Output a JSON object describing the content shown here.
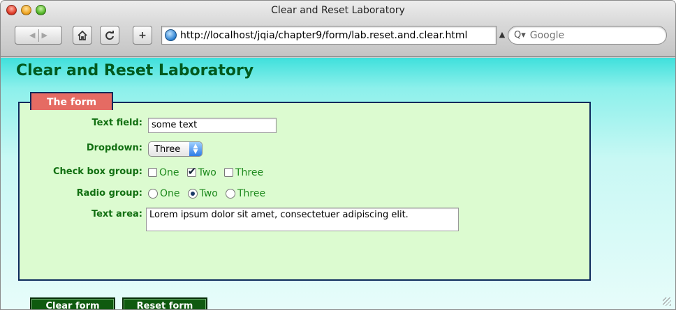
{
  "window": {
    "title": "Clear and Reset Laboratory"
  },
  "toolbar": {
    "back_icon": "back-arrow",
    "forward_icon": "forward-arrow",
    "home_icon": "home",
    "reload_icon": "reload",
    "add_icon": "plus",
    "url": "http://localhost/jqia/chapter9/form/lab.reset.and.clear.html",
    "search_placeholder": "Google"
  },
  "page": {
    "heading": "Clear and Reset Laboratory"
  },
  "form": {
    "legend": "The form",
    "text_field": {
      "label": "Text field:",
      "value": "some text"
    },
    "dropdown": {
      "label": "Dropdown:",
      "value": "Three"
    },
    "checkbox_group": {
      "label": "Check box group:",
      "options": [
        {
          "label": "One",
          "checked": false
        },
        {
          "label": "Two",
          "checked": true
        },
        {
          "label": "Three",
          "checked": false
        }
      ]
    },
    "radio_group": {
      "label": "Radio group:",
      "options": [
        {
          "label": "One",
          "selected": false
        },
        {
          "label": "Two",
          "selected": true
        },
        {
          "label": "Three",
          "selected": false
        }
      ]
    },
    "text_area": {
      "label": "Text area:",
      "value": "Lorem ipsum dolor sit amet, consectetuer adipiscing elit."
    },
    "clear_button": "Clear form",
    "reset_button": "Reset form"
  },
  "colors": {
    "heading": "#005a1e",
    "label": "#116f11",
    "fieldset_bg": "#dcfbd0",
    "legend_bg": "#e56b63",
    "button_bg": "#0f5a0f"
  }
}
